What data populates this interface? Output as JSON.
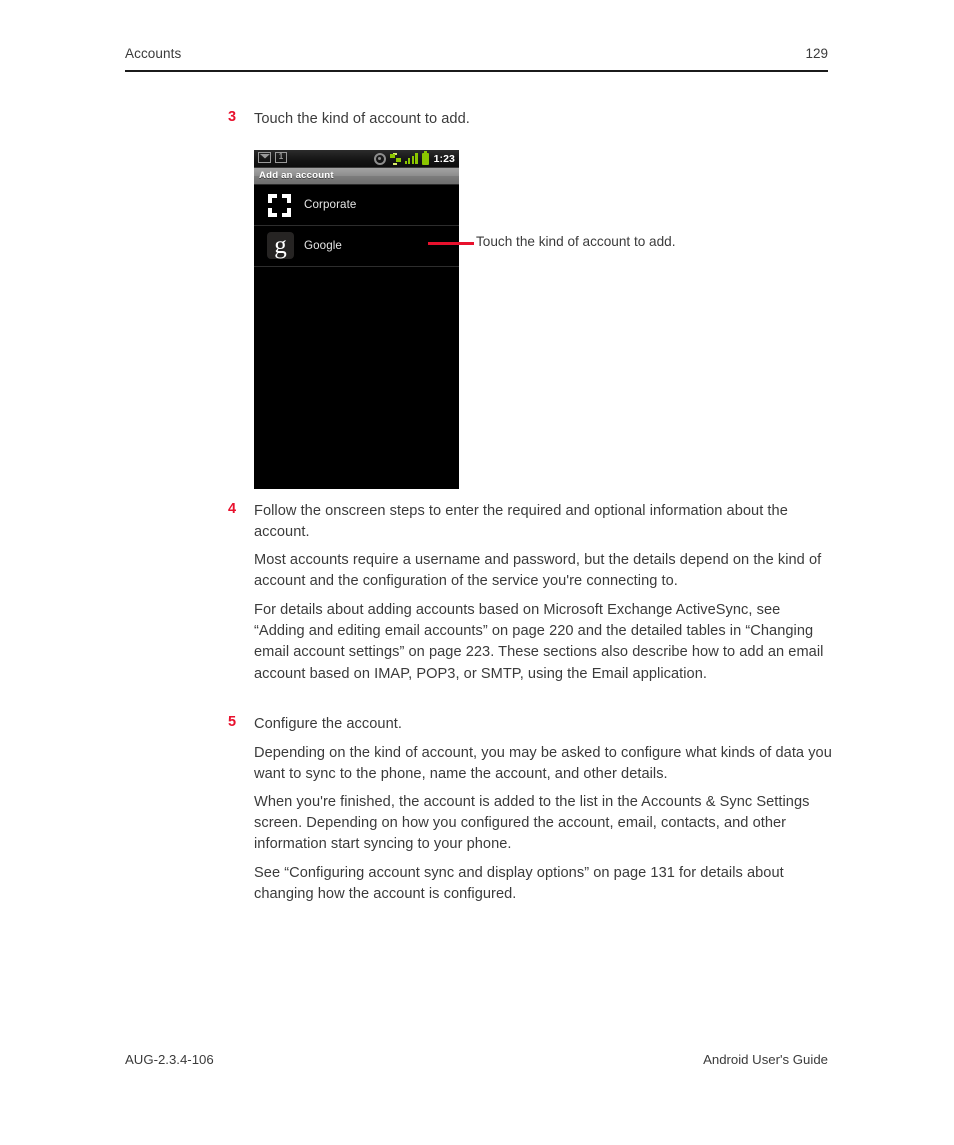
{
  "header": {
    "chapter": "Accounts",
    "page_number": "129"
  },
  "steps": [
    {
      "number": "3",
      "text": "Touch the kind of account to add."
    },
    {
      "number": "4",
      "text": "Follow the onscreen steps to enter the required and optional information about the account."
    },
    {
      "number": "5",
      "text": "Configure the account."
    }
  ],
  "paragraphs": {
    "p4_1": "Most accounts require a username and password, but the details depend on the kind of account and the configuration of the service you're connecting to.",
    "p4_2": "For details about adding accounts based on Microsoft Exchange ActiveSync, see “Adding and editing email accounts” on page 220 and the detailed tables in “Changing email account settings” on page 223. These sections also describe how to add an email account based on IMAP, POP3, or SMTP, using the Email application.",
    "p5_1": "Depending on the kind of account, you may be asked to configure what kinds of data you want to sync to the phone, name the account, and other details.",
    "p5_2": "When you're finished, the account is added to the list in the Accounts & Sync Settings screen. Depending on how you configured the account, email, contacts, and other information start syncing to your phone.",
    "p5_3": "See “Configuring account sync and display options” on page 131 for details about changing how the account is configured."
  },
  "phone": {
    "statusbar": {
      "notifications": [
        {
          "icon": "email-icon"
        },
        {
          "icon": "notification-count-icon",
          "label": "1"
        }
      ],
      "indicators": [
        {
          "icon": "gps-icon"
        },
        {
          "icon": "sync-icon"
        },
        {
          "icon": "signal-bars-icon"
        },
        {
          "icon": "battery-icon"
        }
      ],
      "time": "1:23"
    },
    "title": "Add an account",
    "accounts": [
      {
        "icon": "corporate-icon",
        "label": "Corporate"
      },
      {
        "icon": "google-icon",
        "glyph": "g",
        "label": "Google"
      }
    ]
  },
  "callout": {
    "text": "Touch the kind of account to add.",
    "color": "#e8112d"
  },
  "footer": {
    "left": "AUG-2.3.4-106",
    "right": "Android User's Guide"
  },
  "colors": {
    "accent_red": "#e8112d",
    "body_text": "#3b3b3b",
    "android_green": "#8bc600"
  }
}
